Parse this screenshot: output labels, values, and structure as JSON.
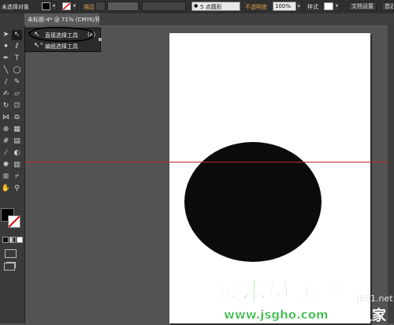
{
  "control_bar": {
    "selection_label": "未选择对象",
    "stroke_label": "描边",
    "brush_value": "5 点圆形",
    "opacity_label": "不透明度",
    "opacity_value": "100%",
    "style_label": "样式",
    "doc_setup_button": "文档设置",
    "prefs_button": "首选项"
  },
  "document": {
    "tab_label": "未标题-4* @ 71% (CMYK/预览)"
  },
  "flyout": {
    "items": [
      {
        "label": "直接选择工具",
        "shortcut": "(A)",
        "icon": "direct-selection-arrow-icon"
      },
      {
        "label": "编组选择工具",
        "icon": "group-selection-arrow-icon"
      }
    ]
  },
  "watermark": {
    "main": "技术员联盟",
    "url": "www.jsgho.com",
    "side": "jb51.net",
    "suffix": "之家"
  },
  "colors": {
    "panel_dark": "#2f2f2f",
    "canvas_bg": "#535353",
    "guide": "#c0262b",
    "ellipse_fill": "#0b0b0b",
    "watermark_green": "#2db83a",
    "accent_orange": "#e4a24b"
  }
}
